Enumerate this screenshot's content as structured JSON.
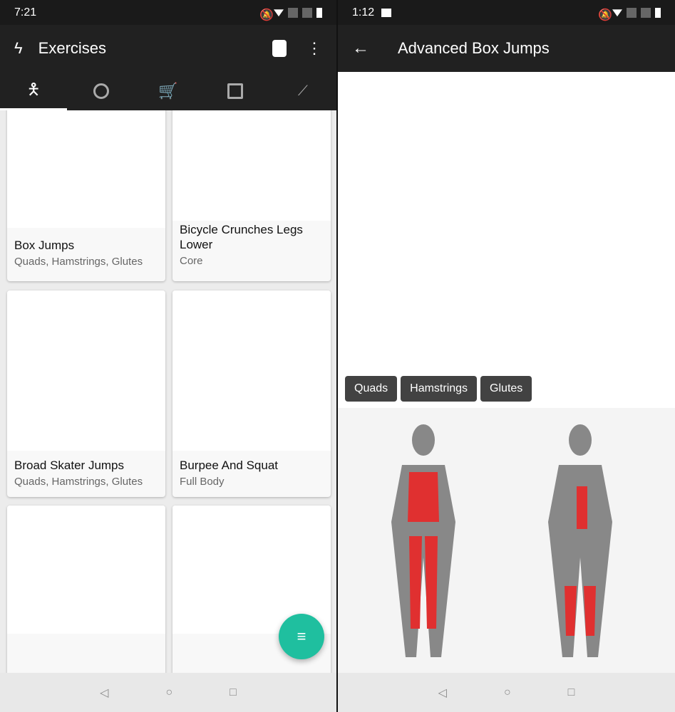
{
  "left": {
    "status": {
      "time": "7:21"
    },
    "appbar": {
      "title": "Exercises",
      "icons": [
        "logo-icon",
        "supplement-icon",
        "more-vert-icon"
      ]
    },
    "tabs": [
      {
        "icon": "exercise-icon",
        "active": true
      },
      {
        "icon": "timer-icon"
      },
      {
        "icon": "cart-icon"
      },
      {
        "icon": "calendar-icon"
      },
      {
        "icon": "trend-icon"
      }
    ],
    "cards": [
      {
        "name": "Box Jumps",
        "muscles": "Quads, Hamstrings, Glutes"
      },
      {
        "name": "Bicycle Crunches Legs Lower",
        "muscles": "Core"
      },
      {
        "name": "Broad Skater Jumps",
        "muscles": "Quads, Hamstrings, Glutes"
      },
      {
        "name": "Burpee And Squat",
        "muscles": "Full Body"
      },
      {
        "name": "",
        "muscles": ""
      },
      {
        "name": "",
        "muscles": ""
      }
    ],
    "fab": {
      "icon": "filter-icon"
    }
  },
  "right": {
    "status": {
      "time": "1:12"
    },
    "appbar": {
      "title": "Advanced Box Jumps"
    },
    "chips": [
      "Quads",
      "Hamstrings",
      "Glutes"
    ],
    "colors": {
      "highlight": "#e03030",
      "body": "#8a8a8a"
    }
  }
}
